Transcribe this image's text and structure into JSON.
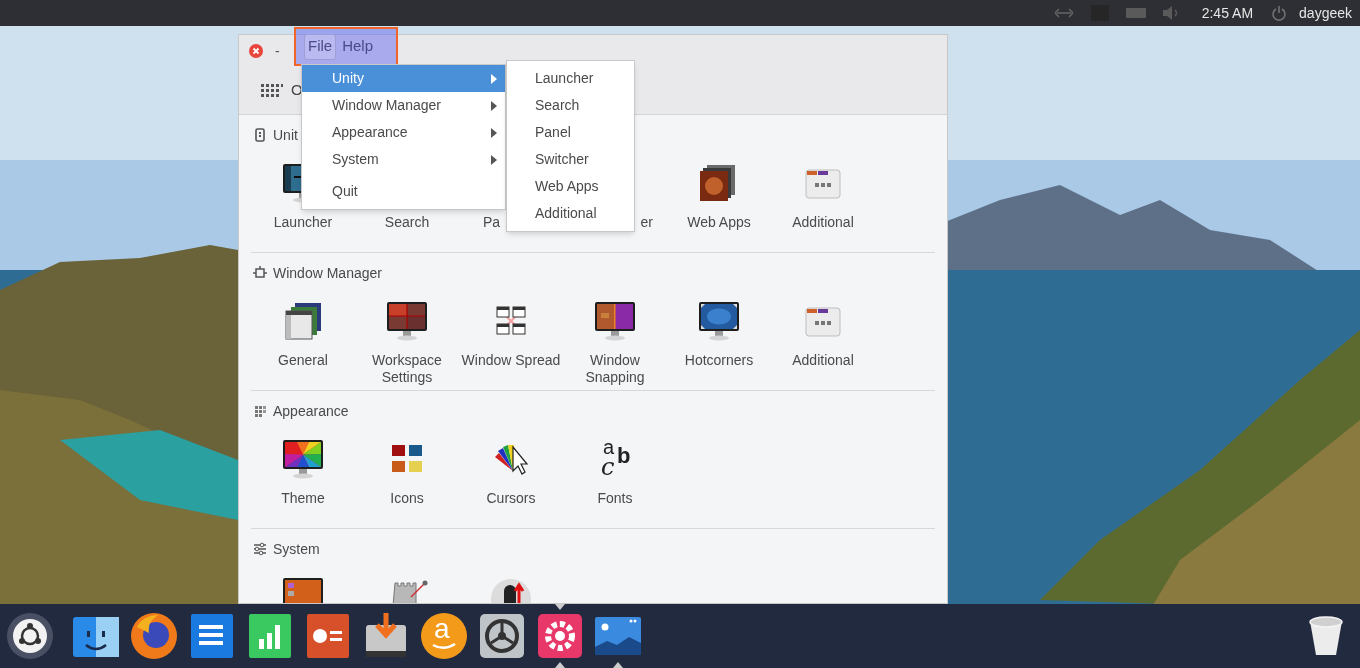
{
  "top_panel": {
    "indicators": [
      {
        "kind": "arrows"
      },
      {
        "kind": "square"
      },
      {
        "kind": "battery"
      },
      {
        "kind": "volume"
      }
    ],
    "clock": "2:45 AM",
    "user": "daygeek"
  },
  "window": {
    "minimize": "-",
    "menus": [
      {
        "label": "File",
        "selected": true
      },
      {
        "label": "Help",
        "selected": false
      }
    ],
    "toolbar": {
      "label": "O"
    },
    "sections": [
      {
        "title": "Unit",
        "kind": "unity",
        "items": [
          {
            "label": "Launcher",
            "kind": "launcher"
          },
          {
            "label": "Search",
            "kind": "covered"
          },
          {
            "label": "Pa",
            "kind": "clipped-start"
          },
          {
            "label": "er",
            "kind": "clipped-end"
          },
          {
            "label": "Web Apps",
            "kind": "webapps"
          },
          {
            "label": "Additional",
            "kind": "dots"
          }
        ]
      },
      {
        "title": "Window Manager",
        "kind": "window",
        "items": [
          {
            "label": "General",
            "kind": "stack"
          },
          {
            "label": "Workspace Settings",
            "kind": "workspace"
          },
          {
            "label": "Window Spread",
            "kind": "spread"
          },
          {
            "label": "Window Snapping",
            "kind": "snapping"
          },
          {
            "label": "Hotcorners",
            "kind": "hotcorners"
          },
          {
            "label": "Additional",
            "kind": "dots"
          }
        ]
      },
      {
        "title": "Appearance",
        "kind": "grid",
        "items": [
          {
            "label": "Theme",
            "kind": "rainbow"
          },
          {
            "label": "Icons",
            "kind": "folders"
          },
          {
            "label": "Cursors",
            "kind": "cursor"
          },
          {
            "label": "Fonts",
            "kind": "fonts",
            "glyphs": [
              "a",
              "c",
              "b"
            ]
          }
        ]
      },
      {
        "title": "System",
        "kind": "sliders",
        "items": [
          {
            "kind": "sysmon"
          },
          {
            "kind": "tower"
          },
          {
            "kind": "mouse"
          }
        ]
      }
    ],
    "menu": {
      "items": [
        {
          "label": "Unity",
          "selected": true,
          "submenu": true
        },
        {
          "label": "Window Manager",
          "selected": false,
          "submenu": true
        },
        {
          "label": "Appearance",
          "selected": false,
          "submenu": true
        },
        {
          "label": "System",
          "selected": false,
          "submenu": true
        },
        {
          "label": "Quit",
          "selected": false,
          "submenu": false
        }
      ]
    },
    "submenu": {
      "items": [
        "Launcher",
        "Search",
        "Panel",
        "Switcher",
        "Web Apps",
        "Additional"
      ]
    }
  },
  "dock": {
    "items": [
      {
        "kind": "ubuntu",
        "running": false,
        "focused": false
      },
      {
        "kind": "finder",
        "running": false,
        "focused": false
      },
      {
        "kind": "firefox",
        "running": false,
        "focused": false
      },
      {
        "kind": "docs",
        "running": false,
        "focused": false
      },
      {
        "kind": "sheets",
        "running": false,
        "focused": false
      },
      {
        "kind": "slides",
        "running": false,
        "focused": false
      },
      {
        "kind": "installer",
        "running": false,
        "focused": false
      },
      {
        "kind": "amazon",
        "glyph": "a",
        "running": false,
        "focused": false
      },
      {
        "kind": "gear",
        "running": false,
        "focused": false
      },
      {
        "kind": "settings",
        "running": true,
        "focused": true
      },
      {
        "kind": "photos",
        "running": true,
        "focused": false
      }
    ],
    "trash": {
      "kind": "trash"
    }
  }
}
